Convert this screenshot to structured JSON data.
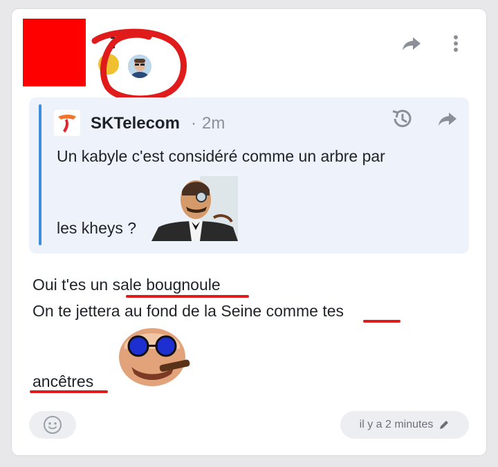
{
  "post": {
    "author_initial": "7",
    "quote": {
      "author": "SKTelecom",
      "separator": "·",
      "time": "2m",
      "text_line1": "Un kabyle c'est considéré comme un arbre par",
      "text_line2": "les kheys ?"
    },
    "body": {
      "line1": "Oui t'es un sale bougnoule",
      "line2": "On te jettera au fond de la Seine comme tes",
      "line3": "ancêtres"
    },
    "footer": {
      "timestamp": "il y a 2 minutes"
    }
  },
  "icons": {
    "share": "share-arrow-icon",
    "more": "more-vertical-icon",
    "history": "history-icon",
    "reaction": "emoji-reaction-icon",
    "edit": "pencil-icon"
  },
  "colors": {
    "card": "#ffffff",
    "quote_bg": "#eef3fb",
    "quote_bar": "#3d8de0",
    "annotation_red": "#e01b1b",
    "muted": "#8a8f98"
  }
}
